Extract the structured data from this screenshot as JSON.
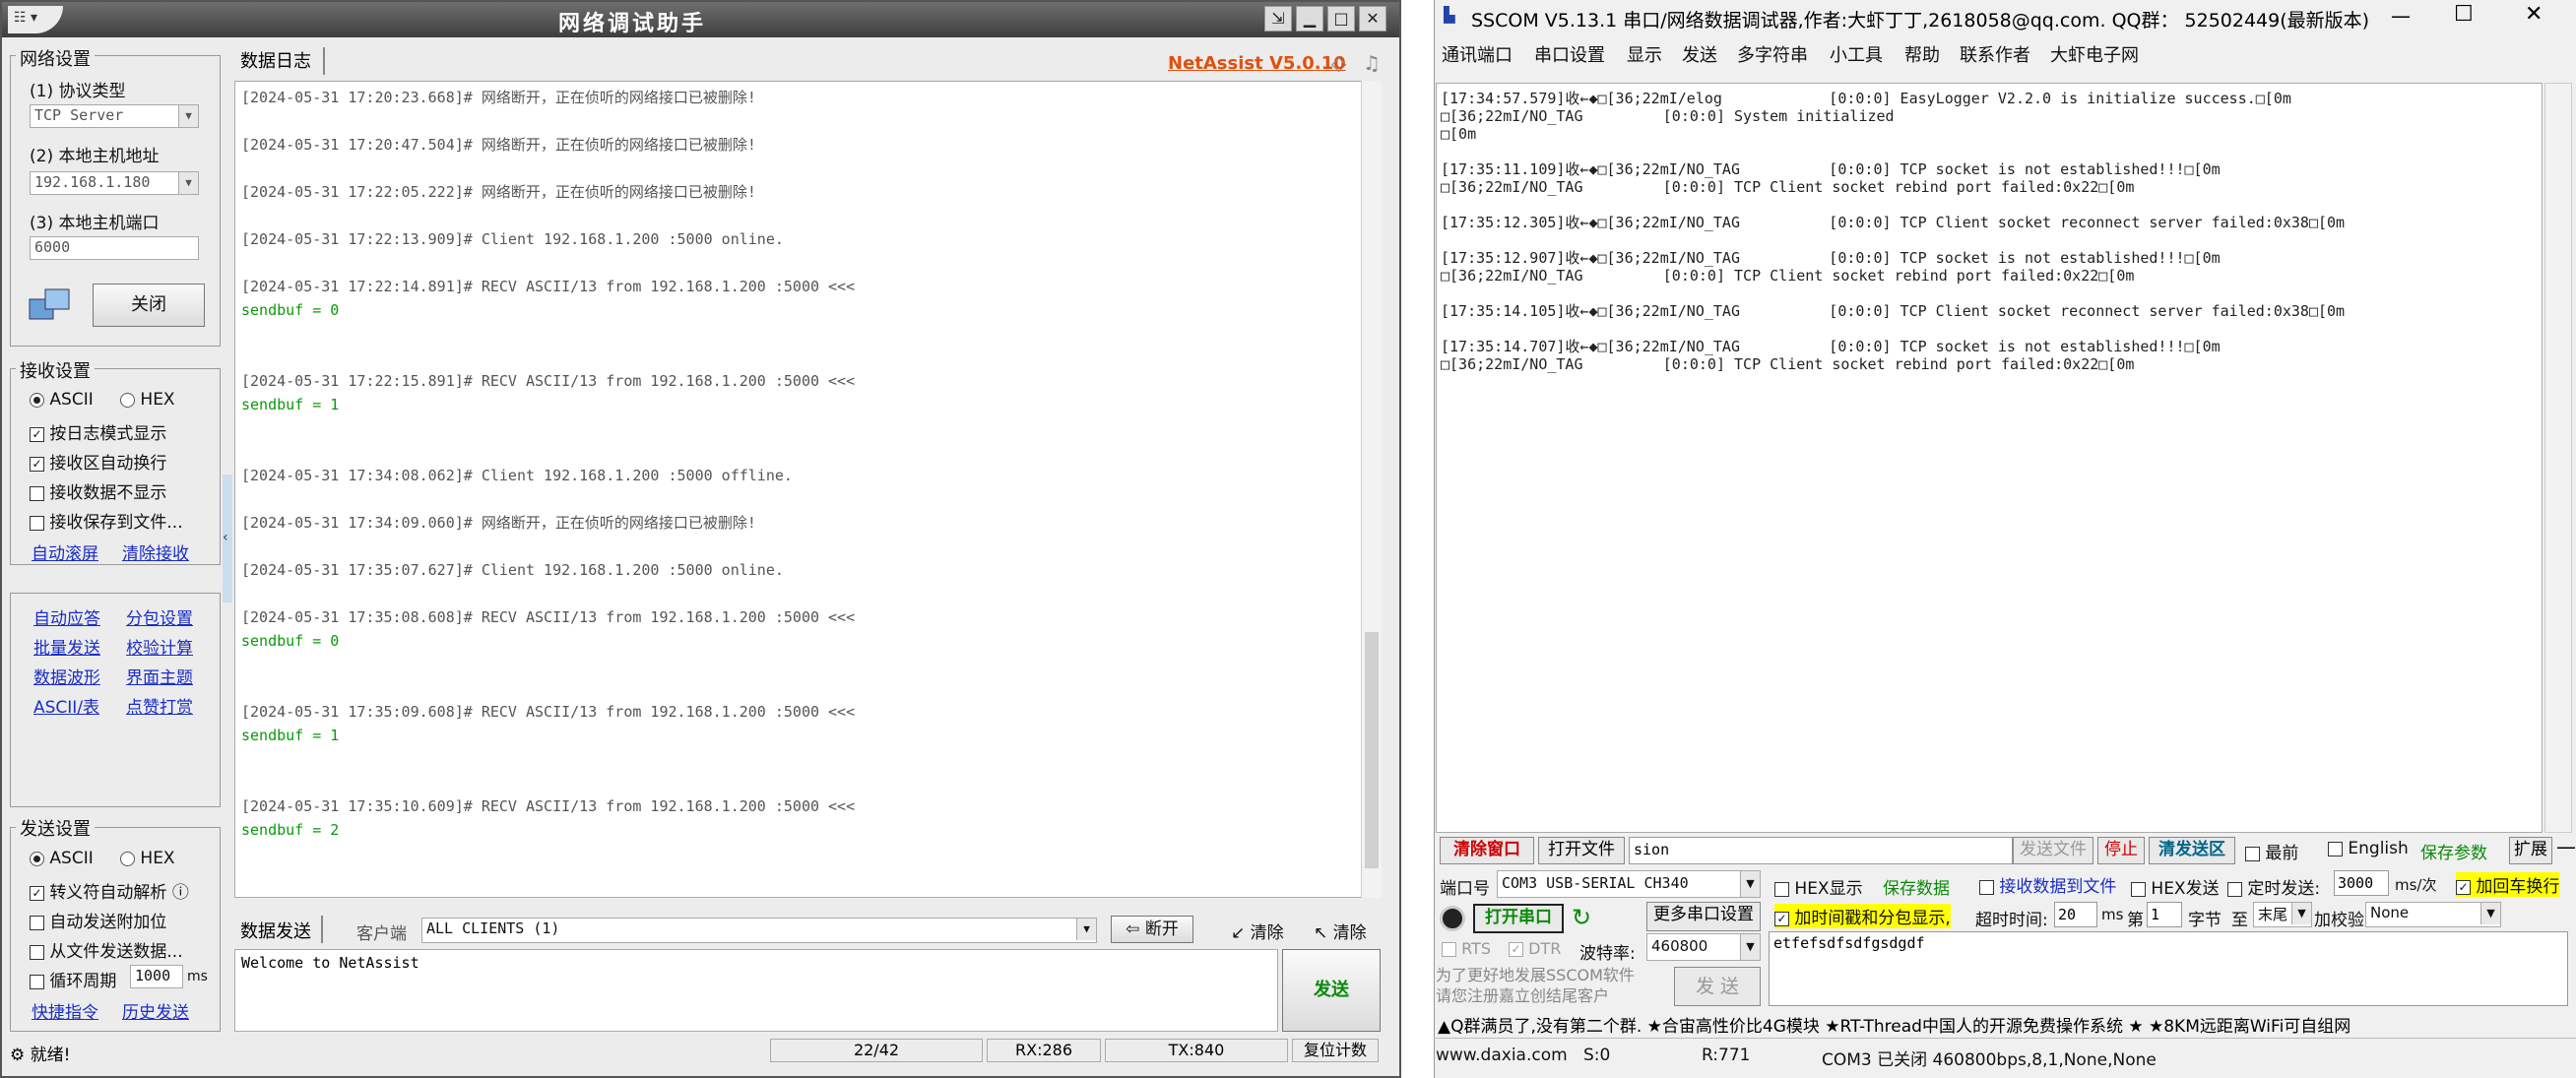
{
  "netassist": {
    "title": "网络调试助手",
    "brand": "NetAssist V5.0.10",
    "log_tab": "数据日志",
    "net_settings": {
      "label": "网络设置",
      "protocol_label": "(1) 协议类型",
      "protocol": "TCP Server",
      "host_label": "(2) 本地主机地址",
      "host": "192.168.1.180",
      "port_label": "(3) 本地主机端口",
      "port": "6000",
      "close_btn": "关闭"
    },
    "recv_settings": {
      "label": "接收设置",
      "ascii": "ASCII",
      "hex": "HEX",
      "opts": [
        {
          "text": "按日志模式显示",
          "checked": "✓"
        },
        {
          "text": "接收区自动换行",
          "checked": "✓"
        },
        {
          "text": "接收数据不显示",
          "checked": ""
        },
        {
          "text": "接收保存到文件...",
          "checked": ""
        }
      ],
      "link1": "自动滚屏",
      "link2": "清除接收"
    },
    "tools": [
      [
        "自动应答",
        "分包设置"
      ],
      [
        "批量发送",
        "校验计算"
      ],
      [
        "数据波形",
        "界面主题"
      ],
      [
        "ASCII/表",
        "点赞打赏"
      ]
    ],
    "send_settings": {
      "label": "发送设置",
      "ascii": "ASCII",
      "hex": "HEX",
      "opts": [
        {
          "text": "转义符自动解析",
          "checked": "✓"
        },
        {
          "text": "自动发送附加位",
          "checked": ""
        },
        {
          "text": "从文件发送数据...",
          "checked": ""
        },
        {
          "text": "循环周期",
          "checked": ""
        }
      ],
      "period": "1000",
      "unit": "ms",
      "link1": "快捷指令",
      "link2": "历史发送"
    },
    "log": [
      {
        "text": "[2024-05-31 17:20:23.668]# 网络断开，正在侦听的网络接口已被删除!",
        "green": ""
      },
      {
        "text": "[2024-05-31 17:20:47.504]# 网络断开，正在侦听的网络接口已被删除!",
        "green": ""
      },
      {
        "text": "[2024-05-31 17:22:05.222]# 网络断开，正在侦听的网络接口已被删除!",
        "green": ""
      },
      {
        "text": "[2024-05-31 17:22:13.909]# Client 192.168.1.200 :5000 online.",
        "green": ""
      },
      {
        "text": "[2024-05-31 17:22:14.891]# RECV ASCII/13 from 192.168.1.200 :5000 <<<",
        "green": "sendbuf = 0"
      },
      {
        "text": "[2024-05-31 17:22:15.891]# RECV ASCII/13 from 192.168.1.200 :5000 <<<",
        "green": "sendbuf = 1"
      },
      {
        "text": "[2024-05-31 17:34:08.062]# Client 192.168.1.200 :5000 offline.",
        "green": ""
      },
      {
        "text": "[2024-05-31 17:34:09.060]# 网络断开，正在侦听的网络接口已被删除!",
        "green": ""
      },
      {
        "text": "[2024-05-31 17:35:07.627]# Client 192.168.1.200 :5000 online.",
        "green": ""
      },
      {
        "text": "[2024-05-31 17:35:08.608]# RECV ASCII/13 from 192.168.1.200 :5000 <<<",
        "green": "sendbuf = 0"
      },
      {
        "text": "[2024-05-31 17:35:09.608]# RECV ASCII/13 from 192.168.1.200 :5000 <<<",
        "green": "sendbuf = 1"
      },
      {
        "text": "[2024-05-31 17:35:10.609]# RECV ASCII/13 from 192.168.1.200 :5000 <<<",
        "green": "sendbuf = 2"
      }
    ],
    "send_tab": "数据发送",
    "client_label": "客户端",
    "client": "ALL CLIENTS (1)",
    "disconnect": "断开",
    "clear1": "清除",
    "clear2": "清除",
    "send_text": "Welcome to NetAssist",
    "send_btn": "发送",
    "status": {
      "ready": "就绪!",
      "count": "22/42",
      "rx": "RX:286",
      "tx": "TX:840",
      "reset": "复位计数"
    }
  },
  "sscom": {
    "title": "SSCOM V5.13.1 串口/网络数据调试器,作者:大虾丁丁,2618058@qq.com. QQ群： 52502449(最新版本)",
    "menu": [
      "通讯端口",
      "串口设置",
      "显示",
      "发送",
      "多字符串",
      "小工具",
      "帮助",
      "联系作者",
      "大虾电子网"
    ],
    "term": [
      "[17:34:57.579]收←◆□[36;22mI/elog            [0:0:0] EasyLogger V2.2.0 is initialize success.□[0m",
      "□[36;22mI/NO_TAG         [0:0:0] System initialized",
      "□[0m",
      "",
      "[17:35:11.109]收←◆□[36;22mI/NO_TAG          [0:0:0] TCP socket is not established!!!□[0m",
      "□[36;22mI/NO_TAG         [0:0:0] TCP Client socket rebind port failed:0x22□[0m",
      "",
      "[17:35:12.305]收←◆□[36;22mI/NO_TAG          [0:0:0] TCP Client socket reconnect server failed:0x38□[0m",
      "",
      "[17:35:12.907]收←◆□[36;22mI/NO_TAG          [0:0:0] TCP socket is not established!!!□[0m",
      "□[36;22mI/NO_TAG         [0:0:0] TCP Client socket rebind port failed:0x22□[0m",
      "",
      "[17:35:14.105]收←◆□[36;22mI/NO_TAG          [0:0:0] TCP Client socket reconnect server failed:0x38□[0m",
      "",
      "[17:35:14.707]收←◆□[36;22mI/NO_TAG          [0:0:0] TCP socket is not established!!!□[0m",
      "□[36;22mI/NO_TAG         [0:0:0] TCP Client socket rebind port failed:0x22□[0m"
    ],
    "clear_win": "清除窗口",
    "open_file": "打开文件",
    "file_field": "sion",
    "send_file": "发送文件",
    "stop": "停止",
    "clear_send": "清发送区",
    "last": "最前",
    "english": "English",
    "save_params": "保存参数",
    "expand": "扩展",
    "port_label": "端口号",
    "port": "COM3 USB-SERIAL CH340",
    "hex_show": "HEX显示",
    "save_data": "保存数据",
    "recv_to_file": "接收数据到文件",
    "hex_send": "HEX发送",
    "timed_send": "定时发送:",
    "timed_val": "3000",
    "timed_unit": "ms/次",
    "add_crlf": "加回车换行",
    "open_port": "打开串口",
    "more_settings": "更多串口设置",
    "timestamp": "加时间戳和分包显示,",
    "timeout_label": "超时时间:",
    "timeout": "20",
    "ms": "ms",
    "nth": "第",
    "nth_val": "1",
    "byte": "字节",
    "to": "至",
    "tail": "末尾",
    "checksum_label": "加校验",
    "checksum": "None",
    "rts": "RTS",
    "dtr": "DTR",
    "baud_label": "波特率:",
    "baud": "460800",
    "send_input": "etfefsdfsdfgsdgdf",
    "promo": "为了更好地发展SSCOM软件\n请您注册嘉立创结尾客户",
    "send_btn": "发 送",
    "ticker": "▲Q群满员了,没有第二个群. ★合宙高性价比4G模块 ★RT-Thread中国人的开源免费操作系统 ★ ★8KM远距离WiFi可自组网",
    "status": {
      "site": "www.daxia.com",
      "s": "S:0",
      "r": "R:771",
      "port": "COM3 已关闭  460800bps,8,1,None,None"
    }
  }
}
